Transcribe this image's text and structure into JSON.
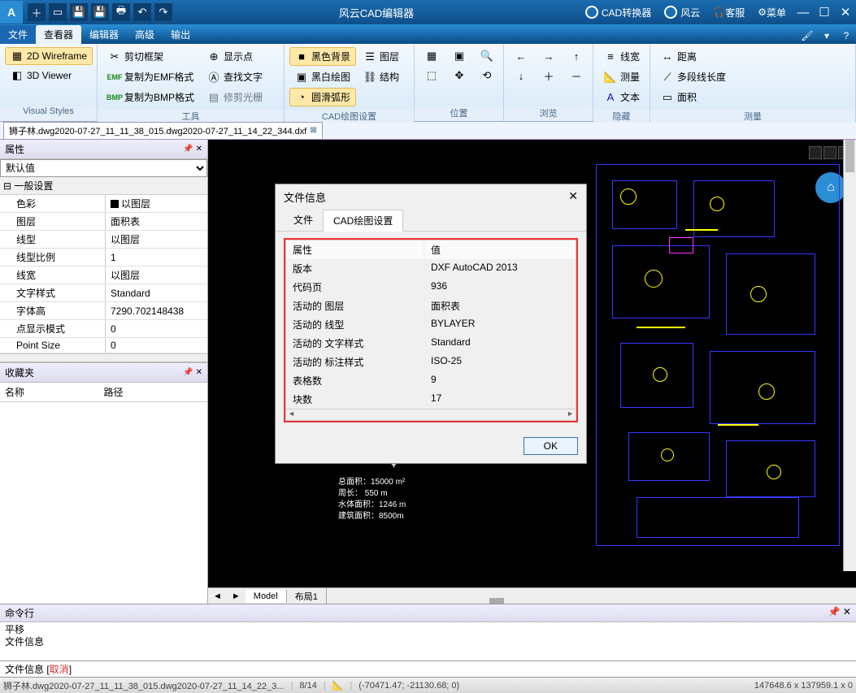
{
  "titlebar": {
    "app_name": "风云CAD编辑器",
    "right_buttons": {
      "converter": "CAD转换器",
      "fengyun": "风云",
      "service": "客服",
      "menu": "菜单"
    }
  },
  "tabs": {
    "file": "文件",
    "viewer": "查看器",
    "editor": "编辑器",
    "advanced": "高级",
    "output": "输出"
  },
  "ribbon": {
    "visual_styles": {
      "label": "Visual Styles",
      "wireframe": "2D Wireframe",
      "viewer3d": "3D Viewer"
    },
    "tools": {
      "label": "工具",
      "clip_frame": "剪切框架",
      "copy_emf": "复制为EMF格式",
      "copy_bmp": "复制为BMP格式",
      "show_points": "显示点",
      "find_text": "查找文字",
      "trim_cursor": "修剪光栅"
    },
    "cad_settings": {
      "label": "CAD绘图设置",
      "black_bg": "黑色背景",
      "white_bg": "黑白绘图",
      "smooth_arc": "圆滑弧形",
      "layers": "图层",
      "structure": "结构"
    },
    "position": {
      "label": "位置"
    },
    "browse": {
      "label": "浏览"
    },
    "hide": {
      "label": "隐藏",
      "linewidth": "线宽",
      "measure": "测量",
      "text": "文本"
    },
    "measure": {
      "label": "测量",
      "distance": "距离",
      "polyline": "多段线长度",
      "area": "面积"
    }
  },
  "doctab": {
    "filename": "狮子林.dwg2020-07-27_11_11_38_015.dwg2020-07-27_11_14_22_344.dxf"
  },
  "properties": {
    "title": "属性",
    "selector": "默认值",
    "section": "一般设置",
    "rows": [
      {
        "k": "色彩",
        "v": "以图层",
        "swatch": true
      },
      {
        "k": "图层",
        "v": "面积表"
      },
      {
        "k": "线型",
        "v": "以图层"
      },
      {
        "k": "线型比例",
        "v": "1"
      },
      {
        "k": "线宽",
        "v": "以图层"
      },
      {
        "k": "文字样式",
        "v": "Standard"
      },
      {
        "k": "字体高",
        "v": "7290.702148438"
      },
      {
        "k": "点显示模式",
        "v": "0"
      },
      {
        "k": "Point Size",
        "v": "0"
      }
    ]
  },
  "favorites": {
    "title": "收藏夹",
    "col_name": "名称",
    "col_path": "路径"
  },
  "canvas": {
    "info": {
      "l1": "总面积：15000 m²",
      "l2": "周长：  550 m",
      "l3": "水体面积：1246 m",
      "l4": "建筑面积：8500m"
    },
    "model_tabs": {
      "model": "Model",
      "layout1": "布局1"
    }
  },
  "command": {
    "title": "命令行",
    "line1": "平移",
    "line2": "文件信息",
    "prompt_prefix": "文件信息  [ ",
    "cancel": "取消",
    "prompt_suffix": " ]"
  },
  "status": {
    "file": "狮子林.dwg2020-07-27_11_11_38_015.dwg2020-07-27_11_14_22_3...",
    "page": "8/14",
    "coords": "(-70471.47; -21130.68; 0)",
    "scale": "147648.6 x 137959.1 x 0"
  },
  "dialog": {
    "title": "文件信息",
    "tabs": {
      "file": "文件",
      "settings": "CAD绘图设置"
    },
    "header_attr": "属性",
    "header_val": "值",
    "rows": [
      {
        "k": "版本",
        "v": "DXF AutoCAD 2013"
      },
      {
        "k": "代码页",
        "v": "936"
      },
      {
        "k": "活动的 图层",
        "v": "面积表"
      },
      {
        "k": "活动的 线型",
        "v": "BYLAYER"
      },
      {
        "k": "活动的 文字样式",
        "v": "Standard"
      },
      {
        "k": "活动的 标注样式",
        "v": "ISO-25"
      },
      {
        "k": "表格数",
        "v": "9"
      },
      {
        "k": "块数",
        "v": "17"
      }
    ],
    "ok": "OK"
  }
}
